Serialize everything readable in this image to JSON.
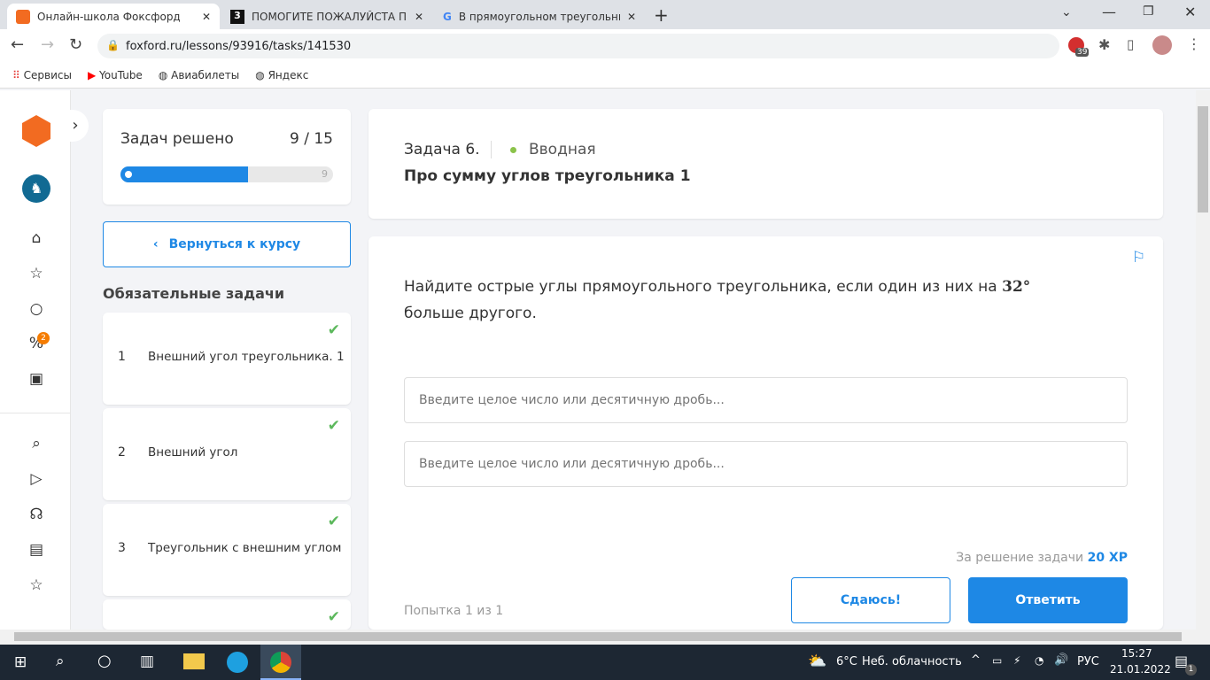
{
  "browser": {
    "tabs": [
      {
        "title": "Онлайн-школа Фоксфорд",
        "active": true
      },
      {
        "title": "ПОМОГИТЕ ПОЖАЛУЙСТА ПРО"
      },
      {
        "title": "В прямоугольном треугольнике"
      }
    ],
    "url": "foxford.ru/lessons/93916/tasks/141530",
    "extension_badge": "39",
    "bookmarks": [
      "Сервисы",
      "YouTube",
      "Авиабилеты",
      "Яндекс"
    ]
  },
  "rail": {
    "notification_badge": "2"
  },
  "progress": {
    "label": "Задач решено",
    "count": "9 / 15",
    "solved": 9,
    "total": 15,
    "fraction": 0.6,
    "end_marker": "9"
  },
  "back_button": "Вернуться к курсу",
  "section_title": "Обязательные задачи",
  "tasks": [
    {
      "num": "1",
      "title": "Внешний угол треугольника. 1",
      "done": true
    },
    {
      "num": "2",
      "title": "Внешний угол",
      "done": true
    },
    {
      "num": "3",
      "title": "Треугольник с внешним углом",
      "done": true
    },
    {
      "done": true
    }
  ],
  "header": {
    "task_no": "Задача 6.",
    "level": "Вводная",
    "title": "Про сумму углов треугольника 1",
    "level_color": "#8bc34a"
  },
  "question": {
    "text_before": "Найдите острые углы прямоугольного треугольника, если один из них на ",
    "value": "32°",
    "text_after": " больше другого."
  },
  "inputs": [
    {
      "placeholder": "Введите целое число или десятичную дробь..."
    },
    {
      "placeholder": "Введите целое число или десятичную дробь..."
    }
  ],
  "reward": {
    "label": "За решение задачи",
    "xp": "20 XP"
  },
  "attempt": "Попытка 1 из 1",
  "buttons": {
    "give_up": "Сдаюсь!",
    "answer": "Ответить"
  },
  "accent": "#1e88e5",
  "taskbar": {
    "weather_temp": "6°C",
    "weather_desc": "Неб. облачность",
    "lang": "РУС",
    "time": "15:27",
    "date": "21.01.2022",
    "notif": "1"
  }
}
